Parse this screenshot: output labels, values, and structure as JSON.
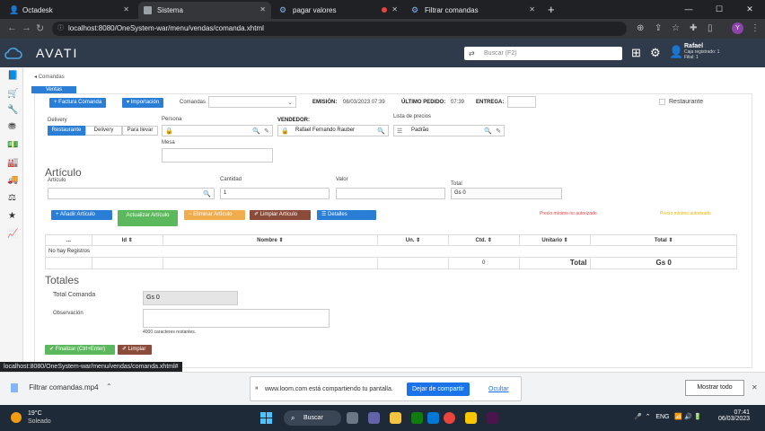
{
  "browser": {
    "tabs": [
      {
        "label": "Octadesk"
      },
      {
        "label": "Sistema"
      },
      {
        "label": "pagar valores"
      },
      {
        "label": "Filtrar comandas"
      }
    ],
    "url": "localhost:8080/OneSystem-war/menu/vendas/comanda.xhtml",
    "profile_initial": "Y"
  },
  "header": {
    "brand": "AVATI",
    "search_placeholder": "Buscar (F2)",
    "user_name": "Rafael",
    "user_line1": "Caja registrado: 1",
    "user_line2": "Filial: 1"
  },
  "breadcrumb": "Comandas",
  "active_tab": "Ventas",
  "toolbar": {
    "factura_comanda": "Factura Comanda",
    "importacion": "Importación",
    "comandas_label": "Comandas",
    "emision_label": "EMISIÓN:",
    "emision_value": "06/03/2023 07:39",
    "ultimo_pedido_label": "ÚLTIMO PEDIDO:",
    "ultimo_pedido_value": "07:39",
    "entrega_label": "ENTREGA:",
    "restaurante_label": "Restaurante"
  },
  "order": {
    "delivery_label": "Delivery",
    "modes": [
      "Restaurante",
      "Delivery",
      "Para llevar"
    ],
    "persona_label": "Persona",
    "vendedor_label": "VENDEDOR:",
    "vendedor_value": "Rafael Fernando Rauber",
    "lista_label": "Lista de precios",
    "lista_value": "Padrão",
    "mesa_label": "Mesa"
  },
  "articulo": {
    "title": "Artículo",
    "articulo_label": "Artículo",
    "cantidad_label": "Cantidad",
    "cantidad_value": "1",
    "valor_label": "Valor",
    "total_label": "Total",
    "total_value": "Gs 0",
    "btn_add": "Añadir Artículo",
    "btn_update": "Actualizar Artículo",
    "btn_remove": "Eliminar Artículo",
    "btn_clear": "Limpiar Artículo",
    "btn_details": "Detalles",
    "warn_price": "Precio mínimo no autorizado",
    "warn_price2": "Precio mínimo autorizado"
  },
  "grid": {
    "headers": [
      "...",
      "Id ⇕",
      "Nombre ⇕",
      "Un. ⇕",
      "Ctd. ⇕",
      "Unitario ⇕",
      "Total ⇕"
    ],
    "empty": "No hay Registros",
    "foot_qty": "0",
    "foot_label": "Total",
    "foot_total": "Gs 0"
  },
  "totales": {
    "title": "Totales",
    "total_comanda_label": "Total Comanda",
    "total_comanda_value": "Gs 0",
    "observacion_label": "Observación",
    "chars_left": "4000 caracteres restantes.",
    "btn_finalizar": "Finalizar (Ctrl+Enter)",
    "btn_limpiar": "Limpiar"
  },
  "status_url": "localhost:8080/OneSystem-war/menu/vendas/comanda.xhtml#",
  "download": {
    "file": "Filtrar comandas.mp4",
    "loom_text": "www.loom.com está compartiendo tu pantalla.",
    "stop_share": "Dejar de compartir",
    "hide": "Ocultar",
    "show_all": "Mostrar todo"
  },
  "taskbar": {
    "temp": "19°C",
    "weather": "Soleado",
    "search": "Buscar",
    "lang": "ENG",
    "time": "07:41",
    "date": "06/03/2023"
  },
  "colors": {
    "primary": "#2b7ed6",
    "green": "#5cb85c",
    "orange": "#f0ad4e",
    "brown": "#8a4b3a",
    "header": "#2f3a4a"
  }
}
